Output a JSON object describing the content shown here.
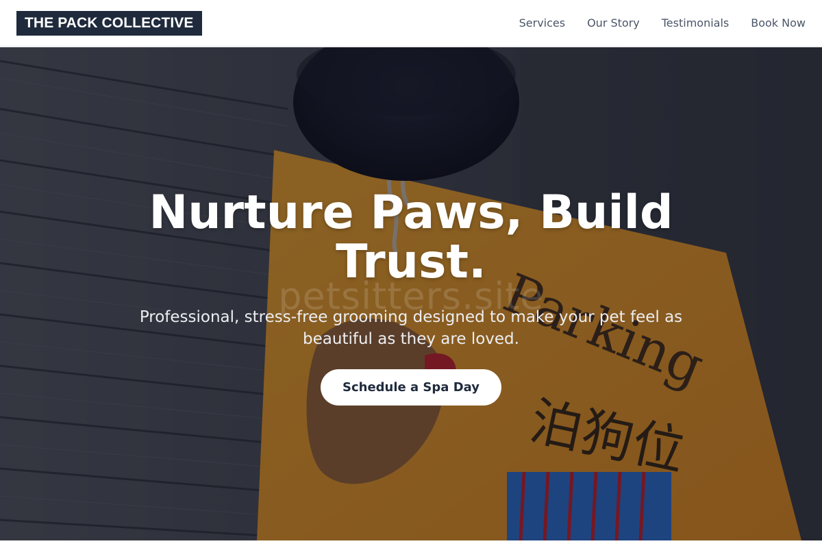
{
  "brand": {
    "name": "THE PACK COLLECTIVE",
    "logo_bg": "#1f2a3c"
  },
  "nav": {
    "links": [
      "Services",
      "Our Story",
      "Testimonials",
      "Book Now"
    ]
  },
  "hero": {
    "title": "Nurture Paws, Build Trust.",
    "subtitle": "Professional, stress-free grooming designed to make your pet feel as beautiful as they are loved.",
    "cta_label": "Schedule a Spa Day",
    "watermark": "petsitters.site",
    "sign_text": "Parking",
    "sign_chinese": "泊狗位",
    "accent_colors": {
      "sign_orange": "#f0a020",
      "wood_dark": "#3a3d45",
      "button_text": "#1f2a3c"
    }
  }
}
